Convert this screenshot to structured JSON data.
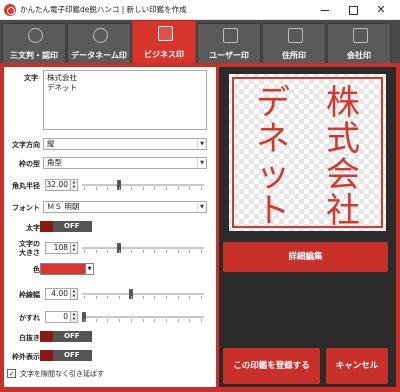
{
  "window": {
    "title": "かんたん電子印鑑de脱ハンコ | 新しい印鑑を作成",
    "close_glyph": "✕"
  },
  "tabs": [
    {
      "label": "三文判・認印"
    },
    {
      "label": "データネーム印"
    },
    {
      "label": "ビジネス印"
    },
    {
      "label": "ユーザー印"
    },
    {
      "label": "住所印"
    },
    {
      "label": "会社印"
    }
  ],
  "form": {
    "text_label": "文字",
    "text_value": "株式会社\nデネット",
    "direction_label": "文字方向",
    "direction_value": "縦",
    "frame_label": "枠の型",
    "frame_value": "角型",
    "radius_label": "角丸半径",
    "radius_value": "32.00",
    "radius_level": 0.3,
    "font_label": "フォント",
    "font_value": "ＭＳ 明朝",
    "bold_label": "太字",
    "bold_value": "OFF",
    "size_label": "文字の\n大きさ",
    "size_value": "108",
    "size_level": 0.3,
    "color_label": "色",
    "color_value": "#d9362c",
    "width_label": "枠線幅",
    "width_value": "4.00",
    "width_level": 0.4,
    "blur_label": "かすれ",
    "blur_value": "0",
    "blur_level": 0.0,
    "hollow_label": "白抜き",
    "hollow_value": "OFF",
    "outside_label": "枠外表示",
    "outside_value": "OFF",
    "stretch_checkbox_label": "文字を隙間なく引き延ばす",
    "stretch_checked": true,
    "check_glyph": "✓"
  },
  "preview": {
    "line1": "株式会社",
    "line2": "デネット",
    "stamp_color": "#d9362c"
  },
  "buttons": {
    "detail_edit": "詳細編集",
    "register": "この印鑑を登録する",
    "cancel": "キャンセル"
  },
  "glyphs": {
    "dropdown": "▼",
    "spin_up": "▲",
    "spin_down": "▼"
  }
}
